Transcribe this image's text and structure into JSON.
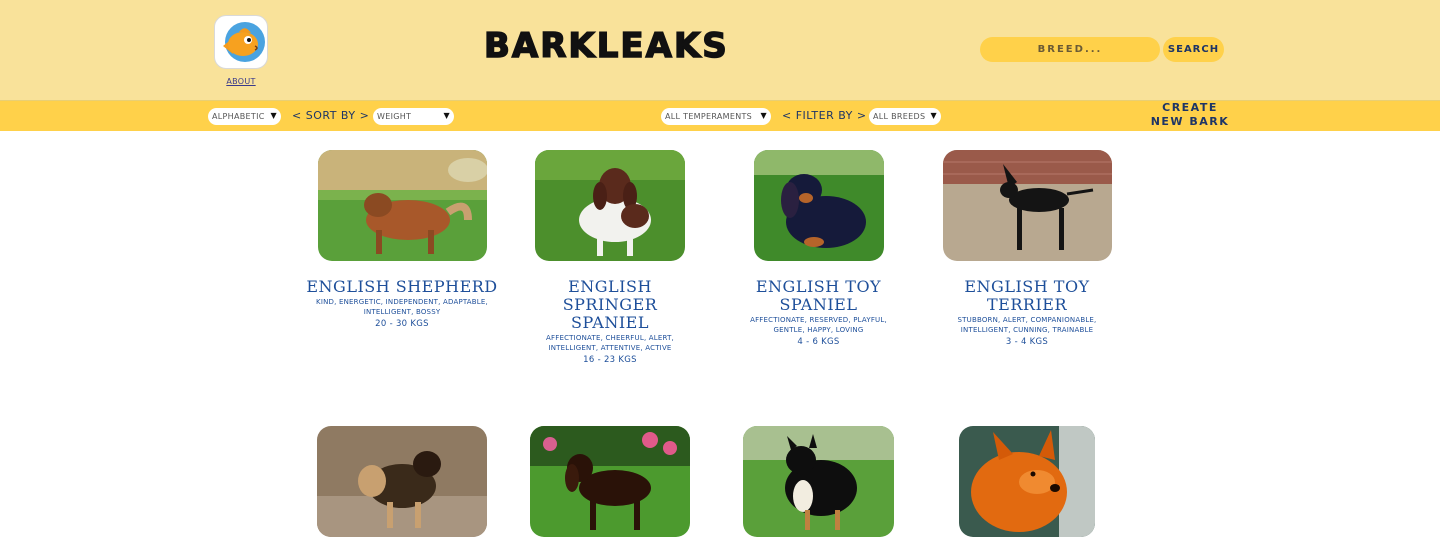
{
  "header": {
    "brand": "BARKLEAKS",
    "about_label": "ABOUT",
    "search": {
      "placeholder": "BREED...",
      "value": ""
    },
    "search_button": "SEARCH",
    "colors": {
      "top_bg": "#f9e29a",
      "bar_bg": "#ffd14a",
      "text_blue": "#1e3566"
    }
  },
  "filters": {
    "order_select": "ALPHABETIC",
    "sort_label": "< SORT BY >",
    "sort_select": "WEIGHT",
    "temperament_select": "ALL TEMPERAMENTS",
    "filter_label": "< FILTER BY >",
    "breed_select": "ALL BREEDS",
    "create_line1": "CREATE",
    "create_line2": "NEW BARK"
  },
  "dogs": [
    {
      "name": "ENGLISH SHEPHERD",
      "temperament": "KIND, ENERGETIC, INDEPENDENT, ADAPTABLE, INTELLIGENT, BOSSY",
      "weight": "20 - 30 KGS"
    },
    {
      "name": "ENGLISH SPRINGER SPANIEL",
      "temperament": "AFFECTIONATE, CHEERFUL, ALERT, INTELLIGENT, ATTENTIVE, ACTIVE",
      "weight": "16 - 23 KGS"
    },
    {
      "name": "ENGLISH TOY SPANIEL",
      "temperament": "AFFECTIONATE, RESERVED, PLAYFUL, GENTLE, HAPPY, LOVING",
      "weight": "4 - 6 KGS"
    },
    {
      "name": "ENGLISH TOY TERRIER",
      "temperament": "STUBBORN, ALERT, COMPANIONABLE, INTELLIGENT, CUNNING, TRAINABLE",
      "weight": "3 - 4 KGS"
    }
  ],
  "icons": {
    "logo": "fish-logo-icon",
    "chevron": "chevron-down-icon"
  }
}
